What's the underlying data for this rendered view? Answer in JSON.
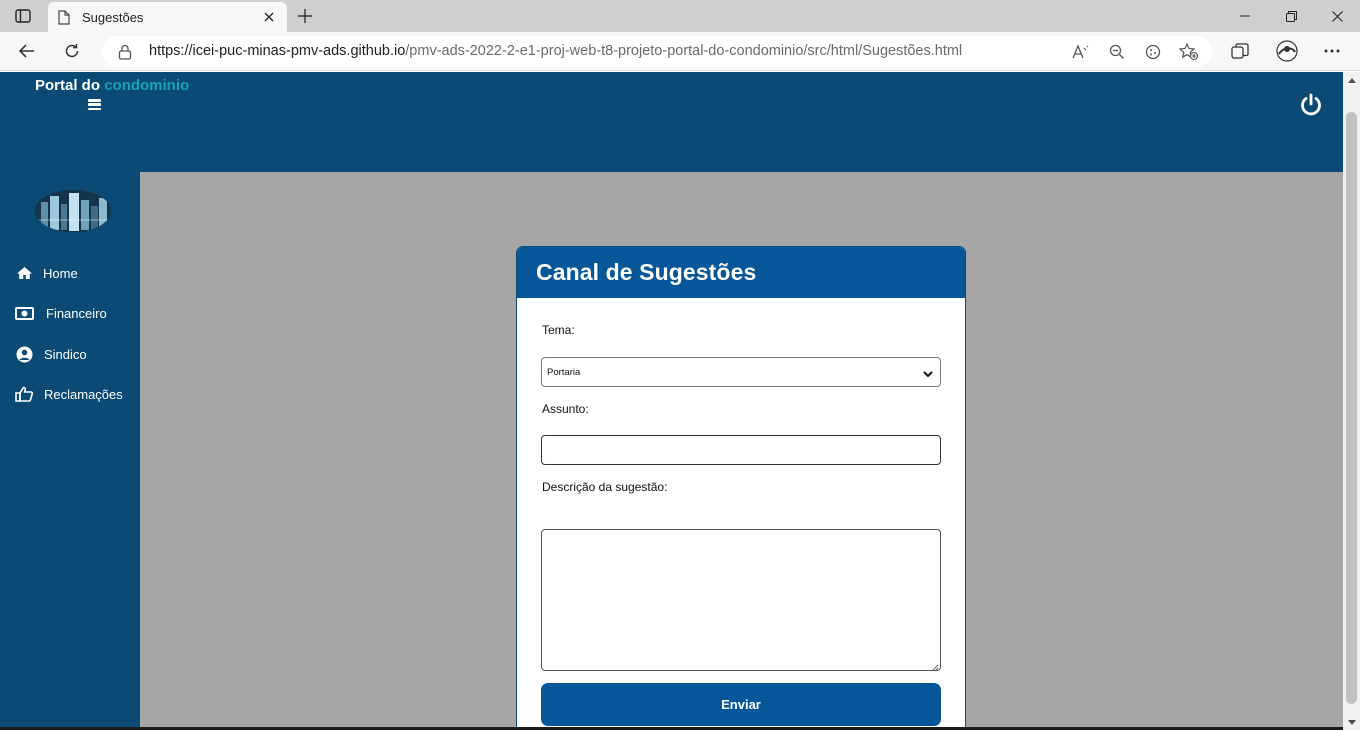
{
  "browser": {
    "tab_title": "Sugestões",
    "url_host": "https://icei-puc-minas-pmv-ads.github.io",
    "url_path": "/pmv-ads-2022-2-e1-proj-web-t8-projeto-portal-do-condominio/src/html/Sugestões.html",
    "icons": [
      "tab-actions-icon",
      "page-icon",
      "close-icon",
      "plus-icon",
      "minimize-icon",
      "restore-icon",
      "close-window-icon",
      "back-icon",
      "refresh-icon",
      "lock-icon",
      "read-aloud-icon",
      "zoom-out-icon",
      "extension-icon",
      "favorite-add-icon",
      "collections-icon",
      "profile-icon",
      "more-icon"
    ]
  },
  "header": {
    "brand_prefix": "Portal do",
    "brand_accent": "condominio"
  },
  "sidebar": {
    "items": [
      {
        "label": "Home",
        "icon": "home-icon"
      },
      {
        "label": "Financeiro",
        "icon": "money-icon"
      },
      {
        "label": "Sindico",
        "icon": "user-circle-icon"
      },
      {
        "label": "Reclamações",
        "icon": "thumbs-down-icon"
      }
    ]
  },
  "form": {
    "title": "Canal de Sugestões",
    "tema_label": "Tema:",
    "tema_value": "Portaria",
    "assunto_label": "Assunto:",
    "assunto_value": "",
    "descricao_label": "Descrição da sugestão:",
    "descricao_value": "",
    "submit_label": "Enviar"
  },
  "colors": {
    "header_bg": "#0a4a74",
    "accent": "#17a2b8",
    "card_header": "#06569a",
    "page_bg": "#a6a6a6"
  }
}
